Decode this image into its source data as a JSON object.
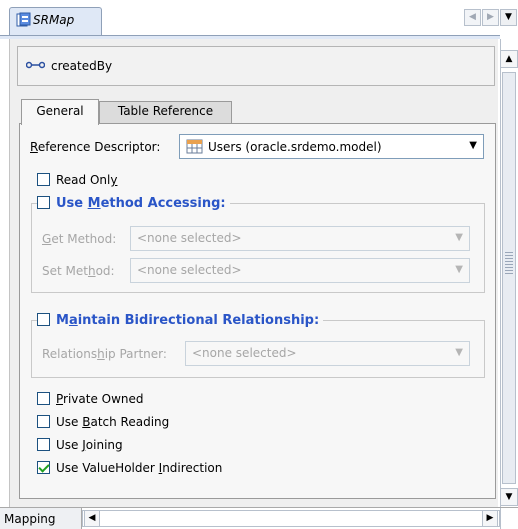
{
  "editor_tab": {
    "title": "SRMap"
  },
  "nav": {
    "left": "◀",
    "right": "▶",
    "menu": "▼"
  },
  "header": {
    "icon": "mapping-link-icon",
    "attribute": "createdBy"
  },
  "tabs": [
    {
      "label": "General",
      "active": true
    },
    {
      "label": "Table Reference",
      "active": false
    }
  ],
  "reference_descriptor": {
    "label_first": "R",
    "label_rest": "eference Descriptor:",
    "value": "Users (oracle.srdemo.model)",
    "arrow": "▼",
    "icon": "table-icon"
  },
  "read_only": {
    "pre": "Read Onl",
    "mn": "y",
    "checked": false
  },
  "method_accessing": {
    "title_pre": "Use ",
    "title_mn": "M",
    "title_post": "ethod Accessing:",
    "checked": false,
    "get_method": {
      "pre": "",
      "mn": "G",
      "post": "et Method:",
      "value": "<none selected>"
    },
    "set_method": {
      "pre": "Set Met",
      "mn": "h",
      "post": "od:",
      "value": "<none selected>"
    }
  },
  "bidirectional": {
    "title_pre": "M",
    "title_mn": "a",
    "title_post": "intain Bidirectional Relationship:",
    "checked": false,
    "partner": {
      "pre": "Relations",
      "mn": "h",
      "post": "ip Partner:",
      "value": "<none selected>"
    }
  },
  "options": [
    {
      "pre": "",
      "mn": "P",
      "post": "rivate Owned",
      "checked": false
    },
    {
      "pre": "Use ",
      "mn": "B",
      "post": "atch Reading",
      "checked": false
    },
    {
      "pre": "Use ",
      "mn": "J",
      "post": "oining",
      "checked": false
    },
    {
      "pre": "Use ValueHolder ",
      "mn": "I",
      "post": "ndirection",
      "checked": true
    }
  ],
  "bottom": {
    "mapping_tab": "Mapping",
    "scroll_left": "◀",
    "scroll_right": "▶"
  },
  "vscroll": {
    "up": "▲",
    "down": "▼"
  },
  "colors": {
    "group_title": "#2a55c7",
    "tab_bg": "#dfe8f6",
    "panel_bg": "#efefef",
    "check": "#21a121"
  }
}
